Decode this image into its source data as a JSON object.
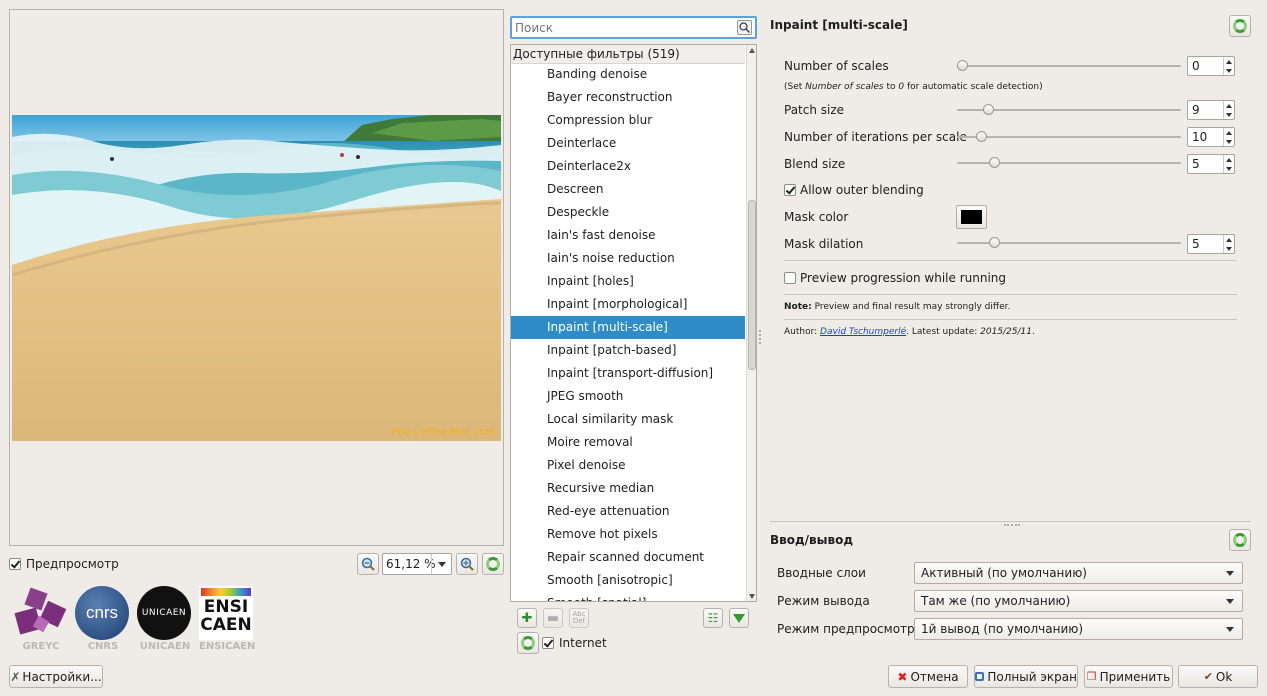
{
  "preview": {
    "checkbox_label": "Предпросмотр",
    "zoom_value": "61,12 %",
    "watermark_text": "Phu-Coffee-Moc.com"
  },
  "logos": [
    {
      "name": "GREYC"
    },
    {
      "name": "CNRS",
      "mark": "cnrs"
    },
    {
      "name": "UNICAEN",
      "mark": "UNICAEN"
    },
    {
      "name": "ENSICAEN",
      "mark_line1": "ENSI",
      "mark_line2": "CAEN"
    }
  ],
  "buttons": {
    "settings": "Настройки...",
    "cancel": "Отмена",
    "fullscreen": "Полный экран",
    "apply": "Применить",
    "ok": "Ok"
  },
  "filters": {
    "search_placeholder": "Поиск",
    "header": "Доступные фильтры (519)",
    "items": [
      "Banding denoise",
      "Bayer reconstruction",
      "Compression blur",
      "Deinterlace",
      "Deinterlace2x",
      "Descreen",
      "Despeckle",
      "Iain's fast denoise",
      "Iain's noise reduction",
      "Inpaint [holes]",
      "Inpaint [morphological]",
      "Inpaint [multi-scale]",
      "Inpaint [patch-based]",
      "Inpaint [transport-diffusion]",
      "JPEG smooth",
      "Local similarity mask",
      "Moire removal",
      "Pixel denoise",
      "Recursive median",
      "Red-eye attenuation",
      "Remove hot pixels",
      "Repair scanned document",
      "Smooth [anisotropic]",
      "Smooth [spatial]"
    ],
    "selected_index": 11,
    "internet_label": "Internet"
  },
  "params": {
    "title": "Inpaint [multi-scale]",
    "number_of_scales": {
      "label": "Number of scales",
      "value": "0",
      "fraction": 0.0
    },
    "scales_hint_a": "(Set ",
    "scales_hint_em": "Number of scales",
    "scales_hint_b": " to ",
    "scales_hint_em2": "0",
    "scales_hint_c": " for automatic scale detection)",
    "patch_size": {
      "label": "Patch size",
      "value": "9",
      "fraction": 0.12
    },
    "iterations": {
      "label": "Number of iterations per scale",
      "value": "10",
      "fraction": 0.09
    },
    "blend_size": {
      "label": "Blend size",
      "value": "5",
      "fraction": 0.15
    },
    "allow_outer_blending": "Allow outer blending",
    "mask_color": {
      "label": "Mask color",
      "color": "#000000"
    },
    "mask_dilation": {
      "label": "Mask dilation",
      "value": "5",
      "fraction": 0.15
    },
    "preview_progression": "Preview progression while running",
    "note_bold": "Note:",
    "note_text": " Preview and final result may strongly differ.",
    "author_prefix": "Author: ",
    "author_name": "David Tschumperlé",
    "author_mid": ". Latest update: ",
    "author_date": "2015/25/11",
    "author_end": "."
  },
  "io": {
    "title": "Ввод/вывод",
    "input_layers": {
      "label": "Вводные слои",
      "value": "Активный (по умолчанию)"
    },
    "output_mode": {
      "label": "Режим вывода",
      "value": "Там же (по умолчанию)"
    },
    "preview_mode": {
      "label": "Режим предпросмотра",
      "value": "1й вывод (по умолчанию)"
    }
  },
  "colors": {
    "selection": "#308cc6",
    "accent_green": "#3d9b3a",
    "window_bg": "#efebe7"
  }
}
